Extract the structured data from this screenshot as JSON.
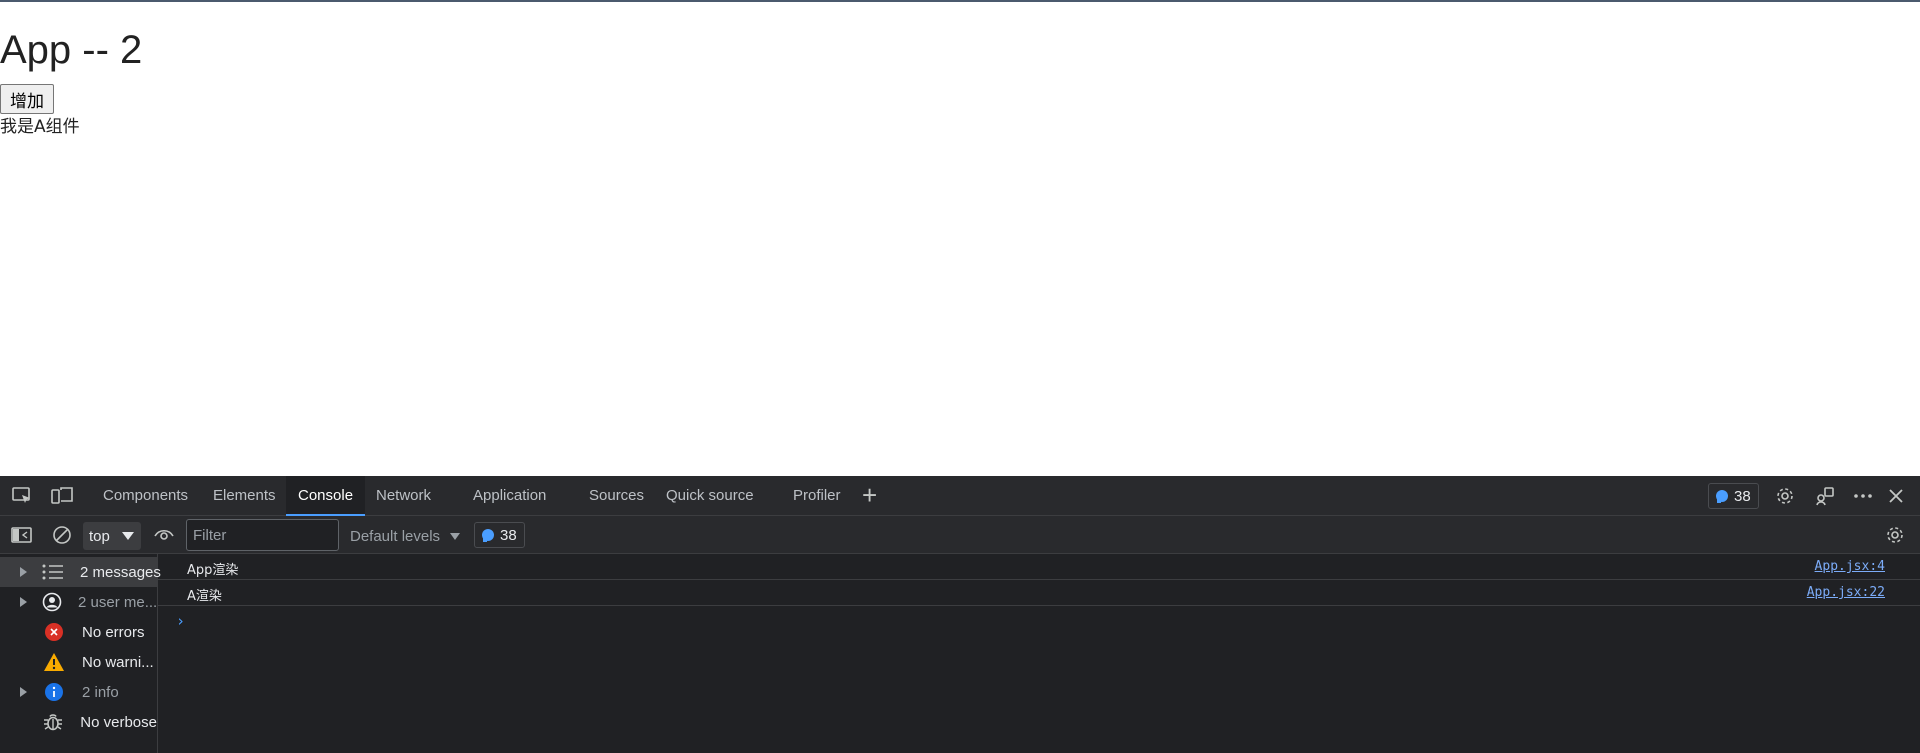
{
  "page": {
    "heading": "App -- 2",
    "add_button_label": "增加",
    "component_a_text": "我是A组件"
  },
  "devtools": {
    "tabs": [
      "Components",
      "Elements",
      "Console",
      "Network",
      "Application",
      "Sources",
      "Quick source",
      "Profiler"
    ],
    "active_tab": "Console",
    "issues_count": "38",
    "toolbar": {
      "context": "top",
      "filter_placeholder": "Filter",
      "levels": "Default levels",
      "issues_count": "38"
    },
    "sidebar": [
      {
        "label": "2 messages",
        "icon": "list-icon",
        "expandable": true,
        "selected": true
      },
      {
        "label": "2 user me...",
        "icon": "user-circle-icon",
        "expandable": true,
        "selected": false
      },
      {
        "label": "No errors",
        "icon": "error-icon",
        "expandable": false,
        "selected": false
      },
      {
        "label": "No warni...",
        "icon": "warning-icon",
        "expandable": false,
        "selected": false
      },
      {
        "label": "2 info",
        "icon": "info-icon",
        "expandable": true,
        "selected": false
      },
      {
        "label": "No verbose",
        "icon": "bug-icon",
        "expandable": false,
        "selected": false
      }
    ],
    "logs": [
      {
        "message": "App渲染",
        "source": "App.jsx:4"
      },
      {
        "message": "A渲染",
        "source": "App.jsx:22"
      }
    ],
    "prompt_symbol": "›"
  },
  "colors": {
    "accent": "#4a9eff",
    "devtools_bg": "#202124",
    "toolbar_bg": "#292a2d",
    "error": "#d93025",
    "warning": "#f9ab00",
    "info": "#1a73e8"
  }
}
